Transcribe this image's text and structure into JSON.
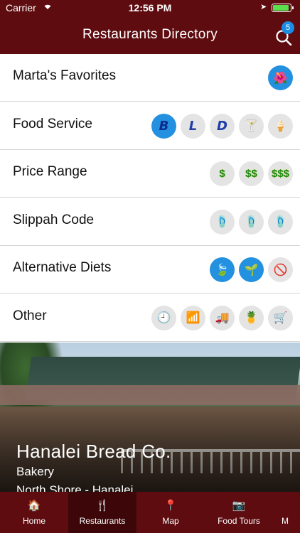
{
  "status": {
    "carrier": "Carrier",
    "time": "12:56 PM",
    "battery_level": 0.9
  },
  "navbar": {
    "title": "Restaurants Directory",
    "badge": "5"
  },
  "filters": [
    {
      "label": "Marta's Favorites",
      "icons": [
        {
          "name": "hibiscus-icon",
          "glyph": "🌺",
          "on": true
        }
      ]
    },
    {
      "label": "Food Service",
      "icons": [
        {
          "name": "breakfast-b-icon",
          "glyph": "B",
          "on": true,
          "letter": true
        },
        {
          "name": "lunch-l-icon",
          "glyph": "L",
          "on": false,
          "letter": true
        },
        {
          "name": "dinner-d-icon",
          "glyph": "D",
          "on": false,
          "letter": true
        },
        {
          "name": "cocktail-icon",
          "glyph": "🍸",
          "on": false
        },
        {
          "name": "ice-cream-icon",
          "glyph": "🍦",
          "on": false
        }
      ]
    },
    {
      "label": "Price Range",
      "icons": [
        {
          "name": "price-one-dollar-icon",
          "glyph": "$",
          "on": false,
          "dollar": true
        },
        {
          "name": "price-two-dollar-icon",
          "glyph": "$$",
          "on": false,
          "dollar": true
        },
        {
          "name": "price-three-dollar-icon",
          "glyph": "$$$",
          "on": false,
          "dollar": true
        }
      ]
    },
    {
      "label": "Slippah Code",
      "icons": [
        {
          "name": "slippah-red-icon",
          "glyph": "🩴",
          "on": false
        },
        {
          "name": "slippah-striped-icon",
          "glyph": "🩴",
          "on": false
        },
        {
          "name": "slippah-blue-icon",
          "glyph": "🩴",
          "on": false
        }
      ]
    },
    {
      "label": "Alternative Diets",
      "icons": [
        {
          "name": "vegetarian-leaf-icon",
          "glyph": "🍃",
          "on": true
        },
        {
          "name": "vegan-icon",
          "glyph": "🌱",
          "on": true
        },
        {
          "name": "gluten-free-icon",
          "glyph": "🚫",
          "on": false
        }
      ]
    },
    {
      "label": "Other",
      "icons": [
        {
          "name": "clock-icon",
          "glyph": "🕘",
          "on": false
        },
        {
          "name": "wifi-icon",
          "glyph": "📶",
          "on": false
        },
        {
          "name": "food-truck-icon",
          "glyph": "🚚",
          "on": false
        },
        {
          "name": "pineapple-icon",
          "glyph": "🍍",
          "on": false
        },
        {
          "name": "grocery-icon",
          "glyph": "🛒",
          "on": false
        }
      ]
    }
  ],
  "featured": {
    "name": "Hanalei Bread Co.",
    "category": "Bakery",
    "location": "North Shore - Hanalei"
  },
  "tabs": [
    {
      "label": "Home",
      "icon": "🏠",
      "name": "home-icon"
    },
    {
      "label": "Restaurants",
      "icon": "🍴",
      "name": "fork-knife-icon",
      "active": true
    },
    {
      "label": "Map",
      "icon": "📍",
      "name": "map-pin-icon"
    },
    {
      "label": "Food Tours",
      "icon": "📷",
      "name": "food-tours-icon"
    },
    {
      "label": "M",
      "icon": "",
      "name": "more-icon",
      "clip": true
    }
  ]
}
